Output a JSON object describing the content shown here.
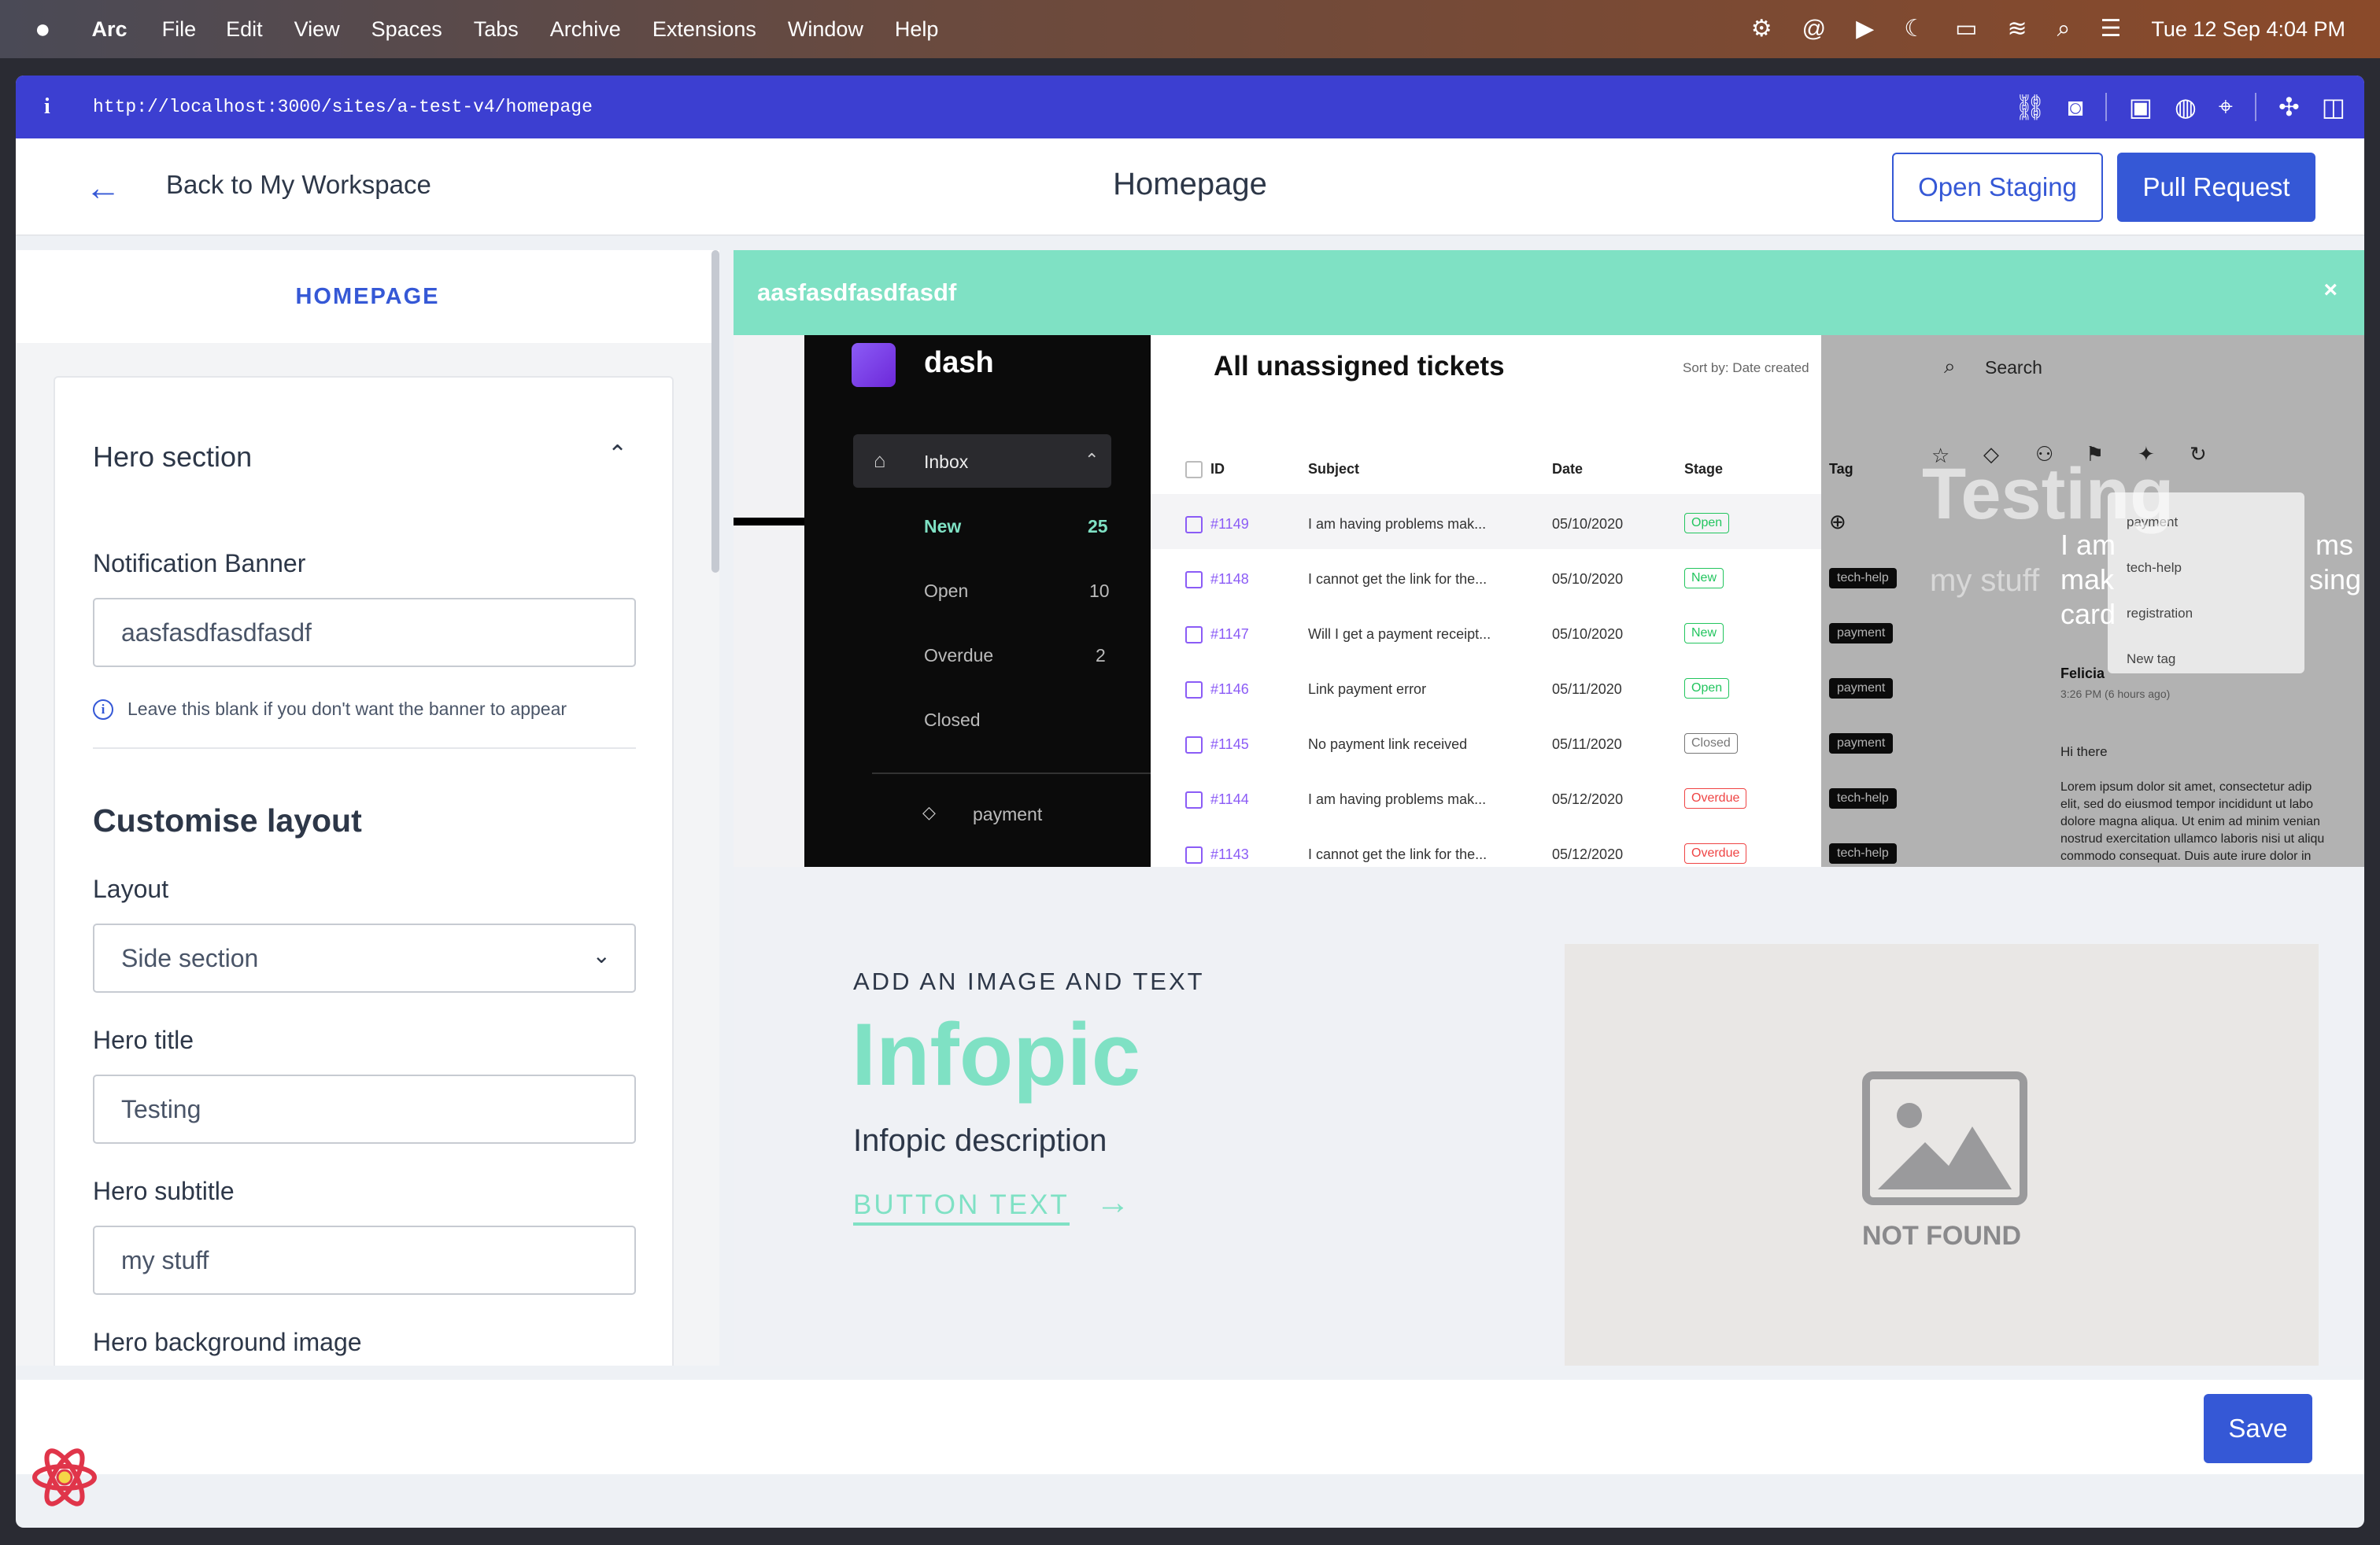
{
  "menubar": {
    "app": "Arc",
    "items": [
      "File",
      "Edit",
      "View",
      "Spaces",
      "Tabs",
      "Archive",
      "Extensions",
      "Window",
      "Help"
    ],
    "datetime": "Tue 12 Sep  4:04 PM"
  },
  "browser": {
    "url": "http://localhost:3000/sites/a-test-v4/homepage",
    "info_icon": "i"
  },
  "header": {
    "back_label": "Back to My Workspace",
    "title": "Homepage",
    "open_staging": "Open Staging",
    "pull_request": "Pull Request"
  },
  "panel": {
    "tab": "HOMEPAGE",
    "hero_section": "Hero section",
    "notification_label": "Notification Banner",
    "notification_value": "aasfasdfasdfasdf",
    "help_text": "Leave this blank if you don't want the banner to appear",
    "customise_title": "Customise layout",
    "layout_label": "Layout",
    "layout_value": "Side section",
    "hero_title_label": "Hero title",
    "hero_title_value": "Testing",
    "hero_subtitle_label": "Hero subtitle",
    "hero_subtitle_value": "my stuff",
    "hero_bg_label": "Hero background image"
  },
  "preview": {
    "banner_text": "aasfasdfasdfasdf",
    "banner_close": "×",
    "dash": {
      "name": "dash",
      "nav": [
        {
          "label": "Inbox",
          "count": ""
        },
        {
          "label": "New",
          "count": "25"
        },
        {
          "label": "Open",
          "count": "10"
        },
        {
          "label": "Overdue",
          "count": "2"
        },
        {
          "label": "Closed",
          "count": ""
        },
        {
          "label": "payment",
          "count": ""
        }
      ],
      "title": "All unassigned tickets",
      "sort": "Sort by: Date created",
      "search": "Search",
      "headers": [
        "ID",
        "Subject",
        "Date",
        "Stage",
        "Tag"
      ],
      "rows": [
        {
          "id": "#1149",
          "subject": "I am having problems mak...",
          "date": "05/10/2020",
          "stage": "Open",
          "tag": ""
        },
        {
          "id": "#1148",
          "subject": "I cannot get the link for the...",
          "date": "05/10/2020",
          "stage": "New",
          "tag": "tech-help"
        },
        {
          "id": "#1147",
          "subject": "Will I get a payment receipt...",
          "date": "05/10/2020",
          "stage": "New",
          "tag": "payment"
        },
        {
          "id": "#1146",
          "subject": "Link payment error",
          "date": "05/11/2020",
          "stage": "Open",
          "tag": "payment"
        },
        {
          "id": "#1145",
          "subject": "No payment link received",
          "date": "05/11/2020",
          "stage": "Closed",
          "tag": "payment"
        },
        {
          "id": "#1144",
          "subject": "I am having problems mak...",
          "date": "05/12/2020",
          "stage": "Overdue",
          "tag": "tech-help"
        },
        {
          "id": "#1143",
          "subject": "I cannot get the link for the...",
          "date": "05/12/2020",
          "stage": "Overdue",
          "tag": "tech-help"
        }
      ],
      "tag_menu": [
        "payment",
        "tech-help",
        "registration",
        "New tag"
      ],
      "right_text": [
        "I am",
        "mak",
        "card",
        "ms",
        "sing",
        "Felicia",
        "3:26 PM (6 hours ago)",
        "Hi there",
        "Lorem ipsum dolor sit amet, consectetur adip",
        "elit, sed do eiusmod tempor incididunt ut labo",
        "dolore magna aliqua. Ut enim ad minim venian",
        "nostrud exercitation ullamco laboris nisi ut aliqu",
        "commodo consequat. Duis aute irure dolor in"
      ]
    },
    "hero_title": "Testing",
    "hero_subtitle": "my stuff",
    "info_kicker": "ADD AN IMAGE AND TEXT",
    "info_title": "Infopic",
    "info_desc": "Infopic description",
    "info_button": "BUTTON TEXT",
    "info_arrow": "→",
    "not_found": "NOT FOUND"
  },
  "footer": {
    "save": "Save"
  },
  "colors": {
    "primary": "#3558d6",
    "accent": "#7fe1c4",
    "urlbar": "#3c3fd1"
  }
}
